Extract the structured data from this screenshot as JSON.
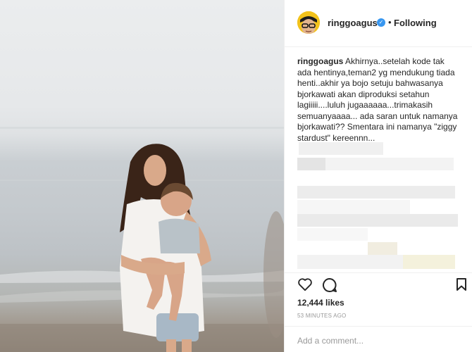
{
  "post": {
    "image": {
      "semantic": "photo-woman-holding-child-at-beach"
    },
    "author": {
      "username": "ringgoagus",
      "verified_icon": "verified-badge-icon",
      "separator": "•",
      "follow_state": "Following"
    },
    "caption": {
      "username": "ringgoagus",
      "text": "Akhirnya..setelah kode tak ada hentinya,teman2 yg mendukung tiada henti..akhir ya bojo setuju bahwasanya bjorkawati akan diproduksi setahun lagiiiii....luluh jugaaaaaa...trimakasih semuanyaaaa... ada saran untuk namanya bjorkawati?? Smentara ini namanya \"ziggy stardust\" kereennn..."
    },
    "actions": {
      "like_icon": "heart-icon",
      "comment_icon": "comment-icon",
      "save_icon": "bookmark-icon"
    },
    "likes": "12,444 likes",
    "timestamp": "53 MINUTES AGO",
    "comment_box": {
      "placeholder": "Add a comment..."
    },
    "colors": {
      "verified": "#3897f0",
      "text": "#262626",
      "muted": "#999999",
      "border": "#efefef"
    }
  }
}
